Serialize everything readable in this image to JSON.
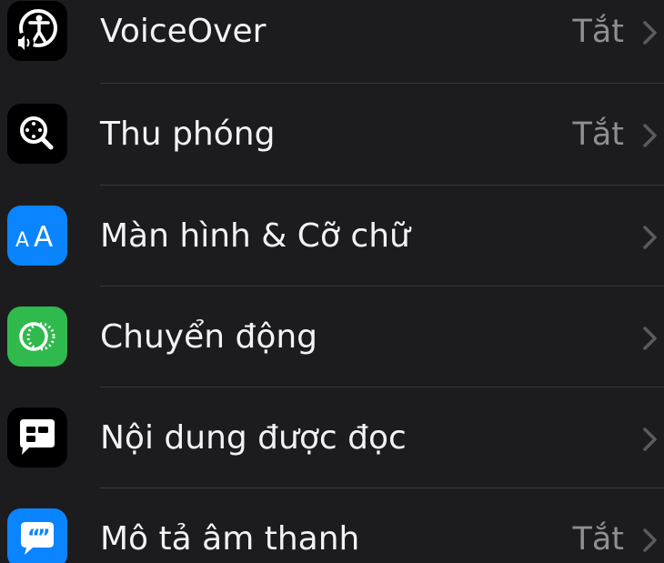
{
  "rows": [
    {
      "label": "VoiceOver",
      "value": "Tắt",
      "icon": "voiceover-icon",
      "icon_bg": "#000000"
    },
    {
      "label": "Thu phóng",
      "value": "Tắt",
      "icon": "zoom-icon",
      "icon_bg": "#000000"
    },
    {
      "label": "Màn hình & Cỡ chữ",
      "value": "",
      "icon": "text-size-icon",
      "icon_bg": "#0a84ff"
    },
    {
      "label": "Chuyển động",
      "value": "",
      "icon": "motion-icon",
      "icon_bg": "#30b94d"
    },
    {
      "label": "Nội dung được đọc",
      "value": "",
      "icon": "spoken-content-icon",
      "icon_bg": "#000000"
    },
    {
      "label": "Mô tả âm thanh",
      "value": "Tắt",
      "icon": "audio-descriptions-icon",
      "icon_bg": "#0a84ff"
    }
  ],
  "colors": {
    "background": "#1c1c1e",
    "label": "#f2f2f7",
    "secondary": "#8e8e93",
    "separator": "#38383a"
  }
}
